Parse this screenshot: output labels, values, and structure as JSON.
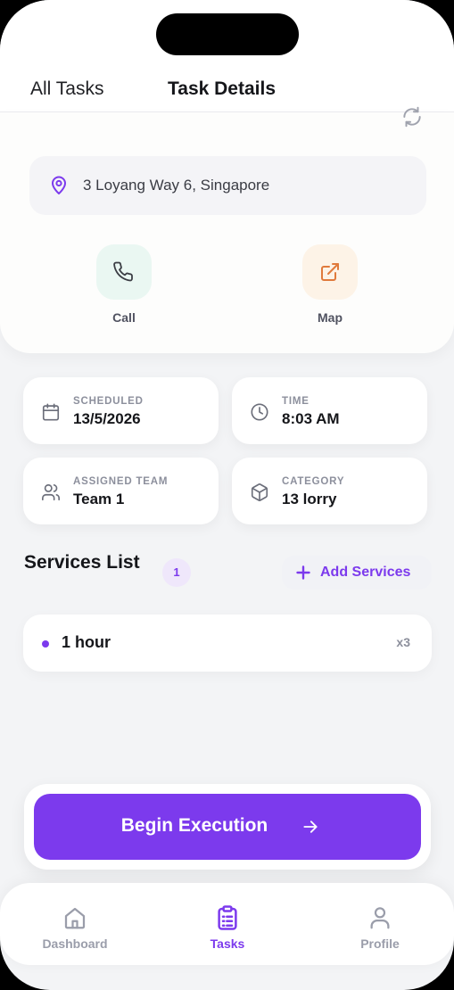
{
  "header": {
    "back_label": "All Tasks",
    "title": "Task Details"
  },
  "location": {
    "address": "3 Loyang Way 6, Singapore"
  },
  "actions": [
    {
      "label": "Call",
      "icon": "phone-icon",
      "color": "#eaf7f2"
    },
    {
      "label": "Map",
      "icon": "external-link-icon",
      "color": "#fdf3e7"
    }
  ],
  "details": {
    "scheduled": {
      "label": "SCHEDULED",
      "value": "13/5/2026",
      "icon": "calendar-icon"
    },
    "time": {
      "label": "TIME",
      "value": "8:03 AM",
      "icon": "clock-icon"
    },
    "team": {
      "label": "ASSIGNED TEAM",
      "value": "Team 1",
      "icon": "users-icon"
    },
    "category": {
      "label": "CATEGORY",
      "value": "13 lorry",
      "icon": "package-icon"
    }
  },
  "services": {
    "title": "Services List",
    "count": "1",
    "add_label": "Add Services",
    "items": [
      {
        "name": "1 hour",
        "qty": "x3"
      }
    ]
  },
  "cta": {
    "label": "Begin Execution"
  },
  "tabbar": [
    {
      "label": "Dashboard",
      "icon": "home-icon",
      "active": false
    },
    {
      "label": "Tasks",
      "icon": "clipboard-list-icon",
      "active": true
    },
    {
      "label": "Profile",
      "icon": "user-icon",
      "active": false
    }
  ],
  "colors": {
    "accent": "#7c3aed",
    "text": "#15161a",
    "muted": "#8c8f9c"
  }
}
